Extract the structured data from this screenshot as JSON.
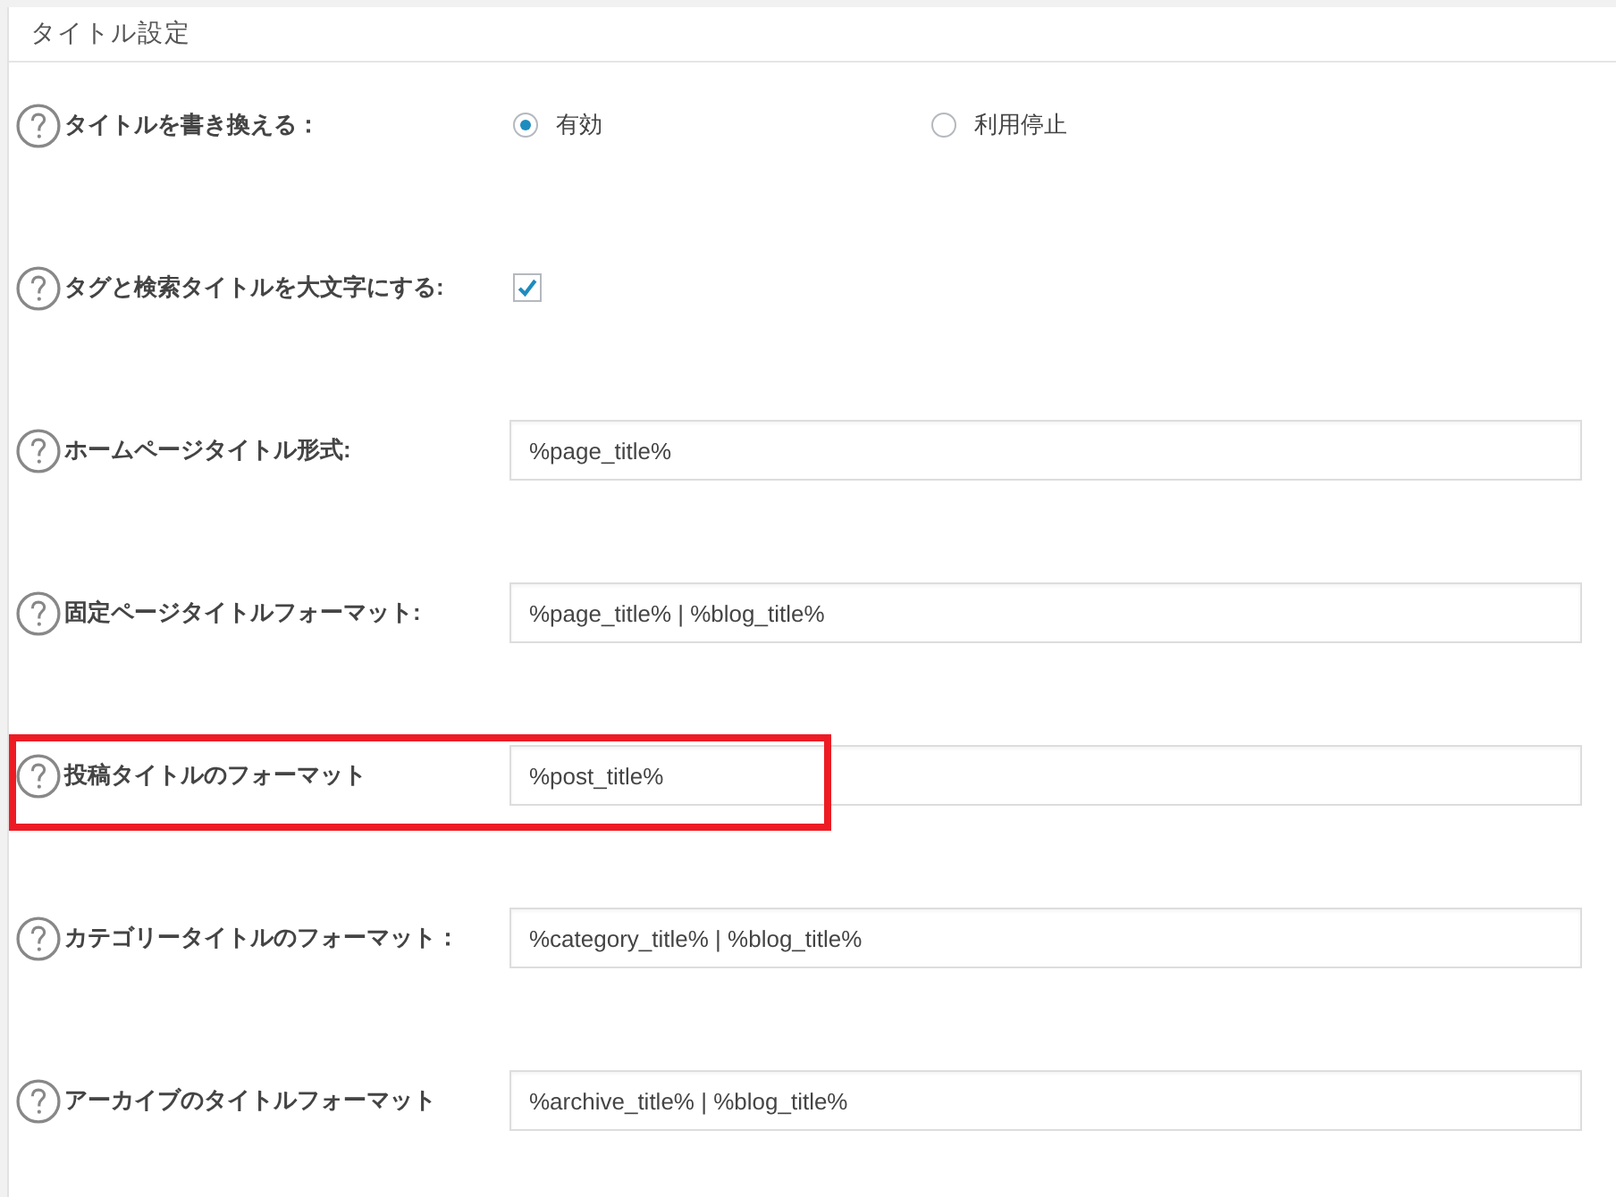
{
  "panel": {
    "title": "タイトル設定"
  },
  "settings": [
    {
      "kind": "radio",
      "label": "タイトルを書き換える：",
      "options": [
        {
          "label": "有効",
          "selected": true
        },
        {
          "label": "利用停止",
          "selected": false
        }
      ],
      "highlighted": false
    },
    {
      "kind": "checkbox",
      "label": "タグと検索タイトルを大文字にする:",
      "checked": true,
      "highlighted": false
    },
    {
      "kind": "text",
      "label": "ホームページタイトル形式:",
      "value": "%page_title%",
      "highlighted": false
    },
    {
      "kind": "text",
      "label": "固定ページタイトルフォーマット:",
      "value": "%page_title% | %blog_title%",
      "highlighted": false
    },
    {
      "kind": "text",
      "label": "投稿タイトルのフォーマット",
      "value": "%post_title%",
      "highlighted": true
    },
    {
      "kind": "text",
      "label": "カテゴリータイトルのフォーマット：",
      "value": "%category_title% | %blog_title%",
      "highlighted": false
    },
    {
      "kind": "text",
      "label": "アーカイブのタイトルフォーマット",
      "value": "%archive_title% | %blog_title%",
      "highlighted": false
    }
  ]
}
